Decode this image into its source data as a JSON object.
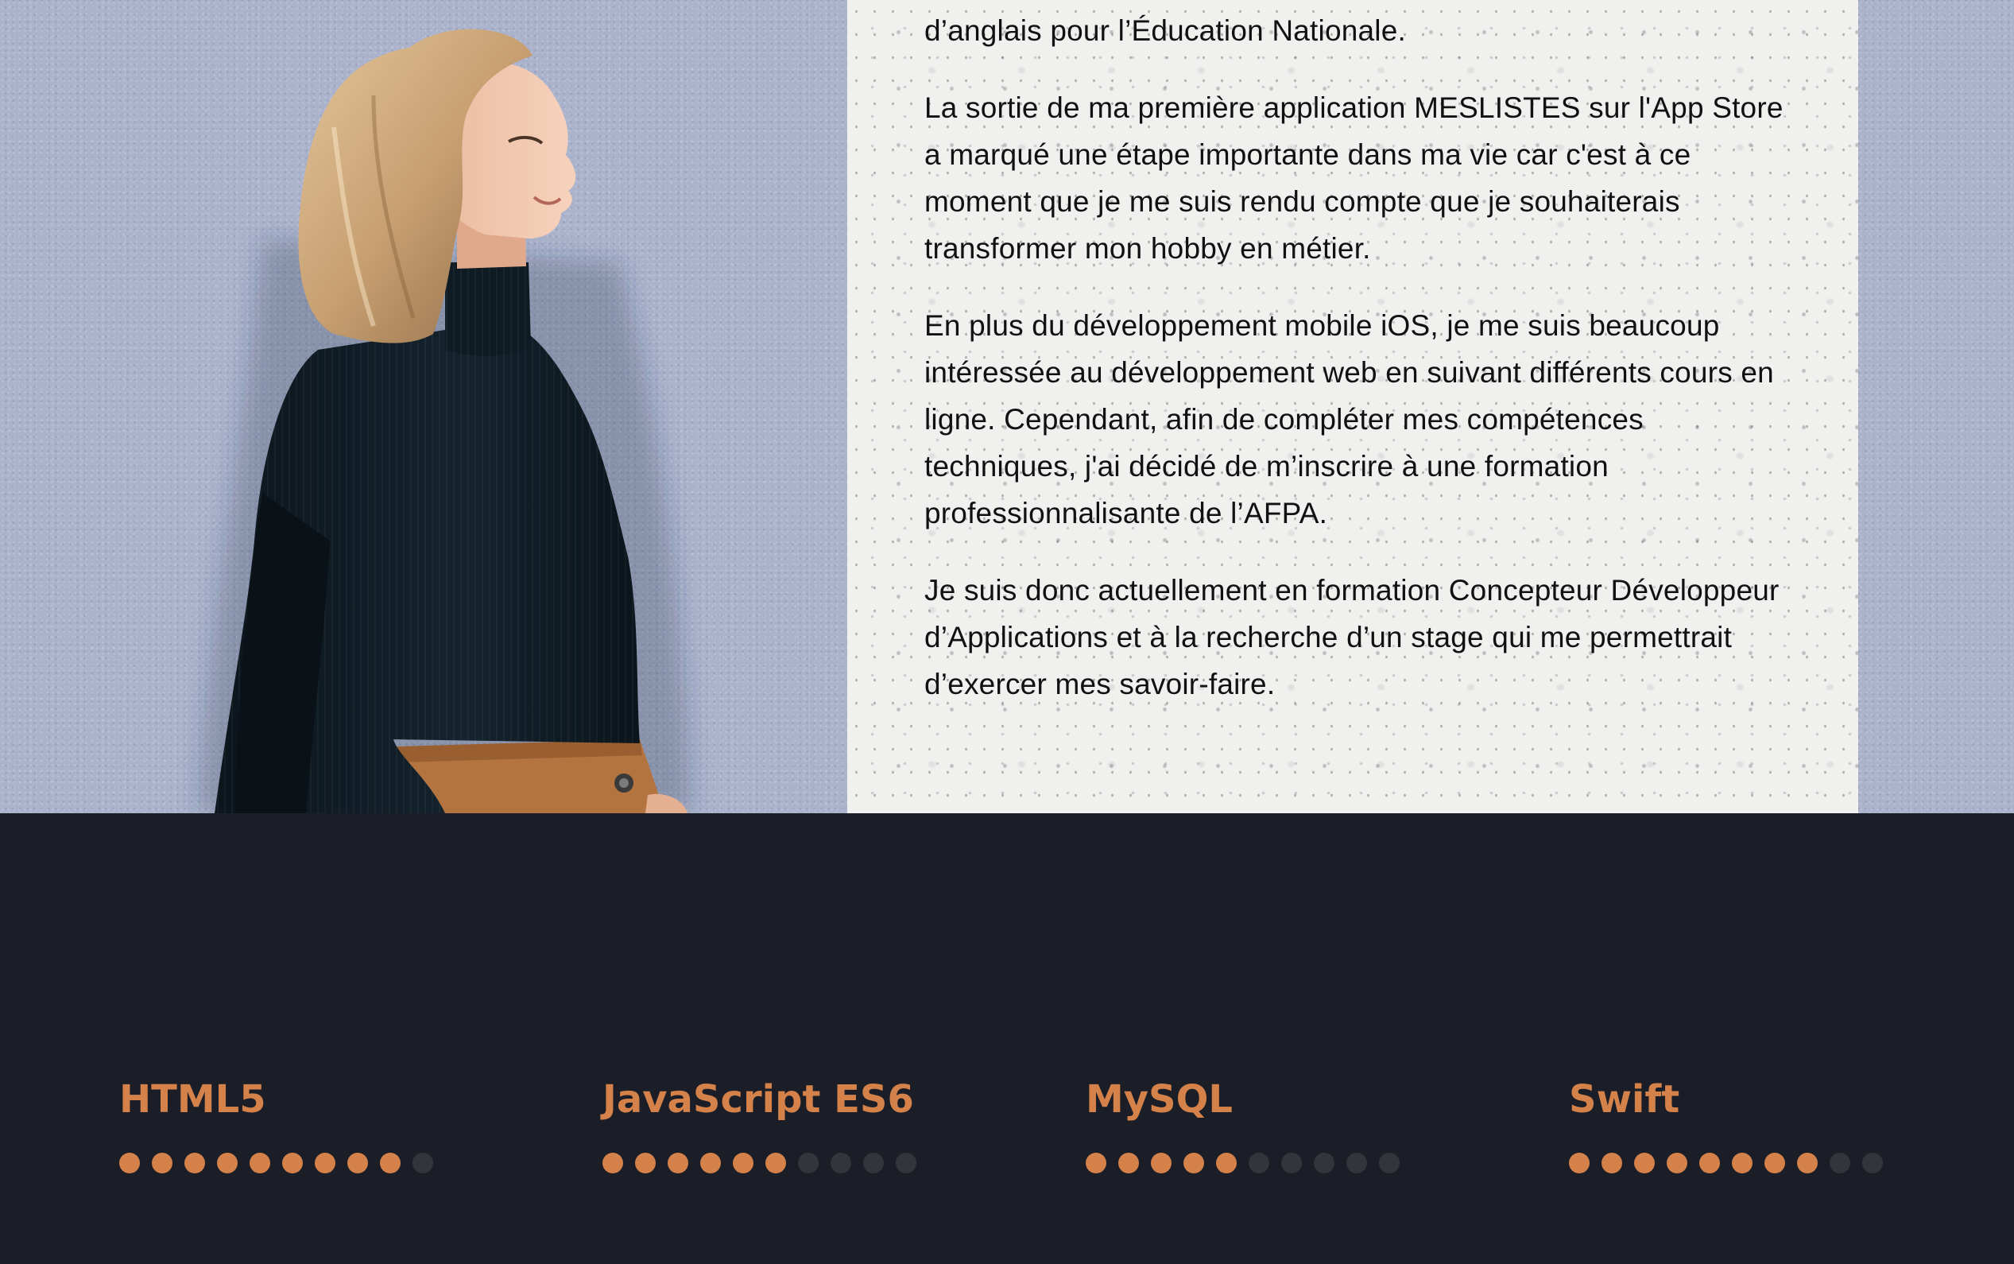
{
  "about": {
    "paragraphs": [
      "d’anglais pour l’Éducation Nationale.",
      "La sortie de ma première application MESLISTES sur l'App Store a marqué une étape importante dans ma vie car c'est à ce moment que je me suis rendu compte que je souhaiterais transformer mon hobby en métier.",
      "En plus du développement mobile iOS, je me suis beaucoup intéressée au développement web en suivant différents cours en ligne. Cependant, afin de compléter mes compétences techniques, j'ai décidé de m’inscrire à une formation professionnalisante de l’AFPA.",
      "Je suis donc actuellement en formation Concepteur Développeur d’Applications et à la recherche d’un stage qui me permettrait d’exercer mes savoir-faire."
    ],
    "portrait_icon": "portrait-photo"
  },
  "skills": [
    {
      "name": "HTML5",
      "level": 9,
      "max": 10
    },
    {
      "name": "JavaScript ES6",
      "level": 6,
      "max": 10
    },
    {
      "name": "MySQL",
      "level": 5,
      "max": 10
    },
    {
      "name": "Swift",
      "level": 8,
      "max": 10
    }
  ],
  "colors": {
    "accent": "#d4824a",
    "dot_inactive": "#34353b",
    "dark_background": "#1b1e27",
    "wall": "#aab2cc",
    "paper": "#f0f0ef"
  }
}
